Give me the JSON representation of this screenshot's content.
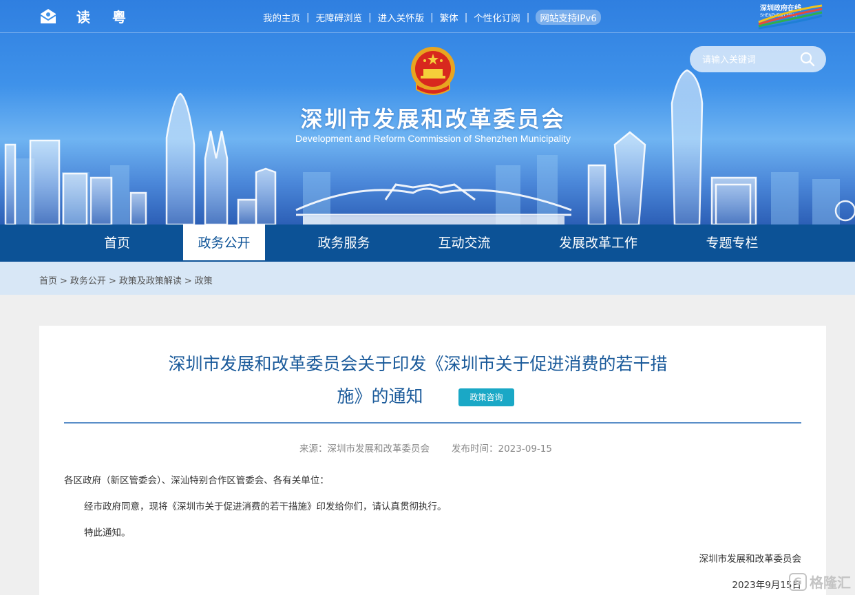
{
  "topbar": {
    "icons": [
      "mail-icon",
      "elder-mode-icon",
      "cantonese-icon"
    ],
    "links": [
      "我的主页",
      "无障碍浏览",
      "进入关怀版",
      "繁体",
      "个性化订阅"
    ],
    "ipv6_label": "网站支持IPv6",
    "logo_text": "深圳政府在线",
    "logo_sub": "SHENZHEN CHINA"
  },
  "header": {
    "title": "深圳市发展和改革委员会",
    "subtitle": "Development and Reform Commission of Shenzhen Municipality"
  },
  "search": {
    "placeholder": "请输入关键词"
  },
  "nav": {
    "items": [
      "首页",
      "政务公开",
      "政务服务",
      "互动交流",
      "发展改革工作",
      "专题专栏"
    ],
    "active_index": 1
  },
  "breadcrumb": [
    "首页",
    "政务公开",
    "政策及政策解读",
    "政策"
  ],
  "article": {
    "title_line1": "深圳市发展和改革委员会关于印发《深圳市关于促进消费的若干措",
    "title_line2": "施》的通知",
    "badge": "政策咨询",
    "source_label": "来源：深圳市发展和改革委员会",
    "date_label": "发布时间：2023-09-15",
    "paragraphs": [
      "各区政府（新区管委会）、深汕特别合作区管委会、各有关单位：",
      "经市政府同意，现将《深圳市关于促进消费的若干措施》印发给你们，请认真贯彻执行。",
      "特此通知。"
    ],
    "signer": "深圳市发展和改革委员会",
    "sign_date": "2023年9月15日"
  },
  "watermark": "格隆汇",
  "colors": {
    "nav_bg": "#0c5296",
    "title_blue": "#1a5a9a",
    "badge": "#1aa8c6",
    "breadcrumb_bg": "#d8e7f6"
  }
}
